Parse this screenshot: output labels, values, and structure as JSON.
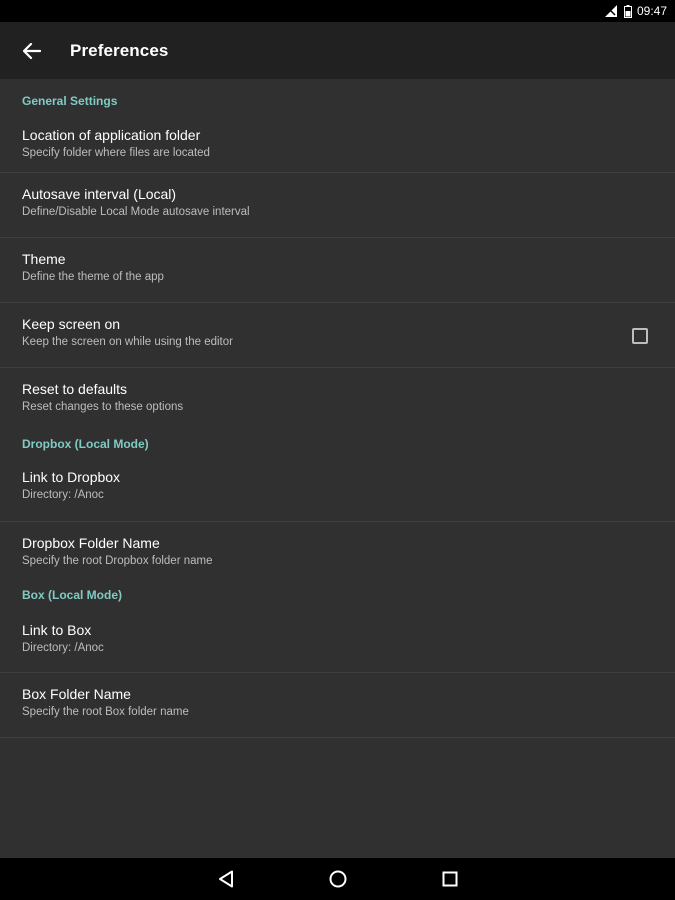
{
  "status_bar": {
    "time": "09:47",
    "icons": [
      "signal-icon",
      "battery-icon"
    ]
  },
  "app_bar": {
    "title": "Preferences",
    "back_icon": "arrow-left-icon"
  },
  "sections": {
    "general": {
      "header": "General Settings",
      "items": [
        {
          "title": "Location of application folder",
          "summary": "Specify folder where files are located"
        },
        {
          "title": "Autosave interval (Local)",
          "summary": "Define/Disable Local Mode autosave interval"
        },
        {
          "title": "Theme",
          "summary": "Define the theme of the app"
        },
        {
          "title": "Keep screen on",
          "summary": "Keep the screen on while using the editor",
          "checked": false
        },
        {
          "title": "Reset to defaults",
          "summary": "Reset changes to these options"
        }
      ]
    },
    "dropbox": {
      "header": "Dropbox (Local Mode)",
      "items": [
        {
          "title": "Link to Dropbox",
          "summary": "Directory: /Anoc"
        },
        {
          "title": "Dropbox Folder Name",
          "summary": "Specify the root Dropbox folder name"
        }
      ]
    },
    "box": {
      "header": "Box (Local Mode)",
      "items": [
        {
          "title": "Link to Box",
          "summary": "Directory: /Anoc"
        },
        {
          "title": "Box Folder Name",
          "summary": "Specify the root Box folder name"
        }
      ]
    }
  },
  "nav_bar": {
    "buttons": [
      "back-triangle-icon",
      "home-circle-icon",
      "recents-square-icon"
    ]
  },
  "colors": {
    "accent": "#80cbc4",
    "background": "#303030",
    "app_bar": "#212121",
    "divider": "#3f3f3f"
  }
}
